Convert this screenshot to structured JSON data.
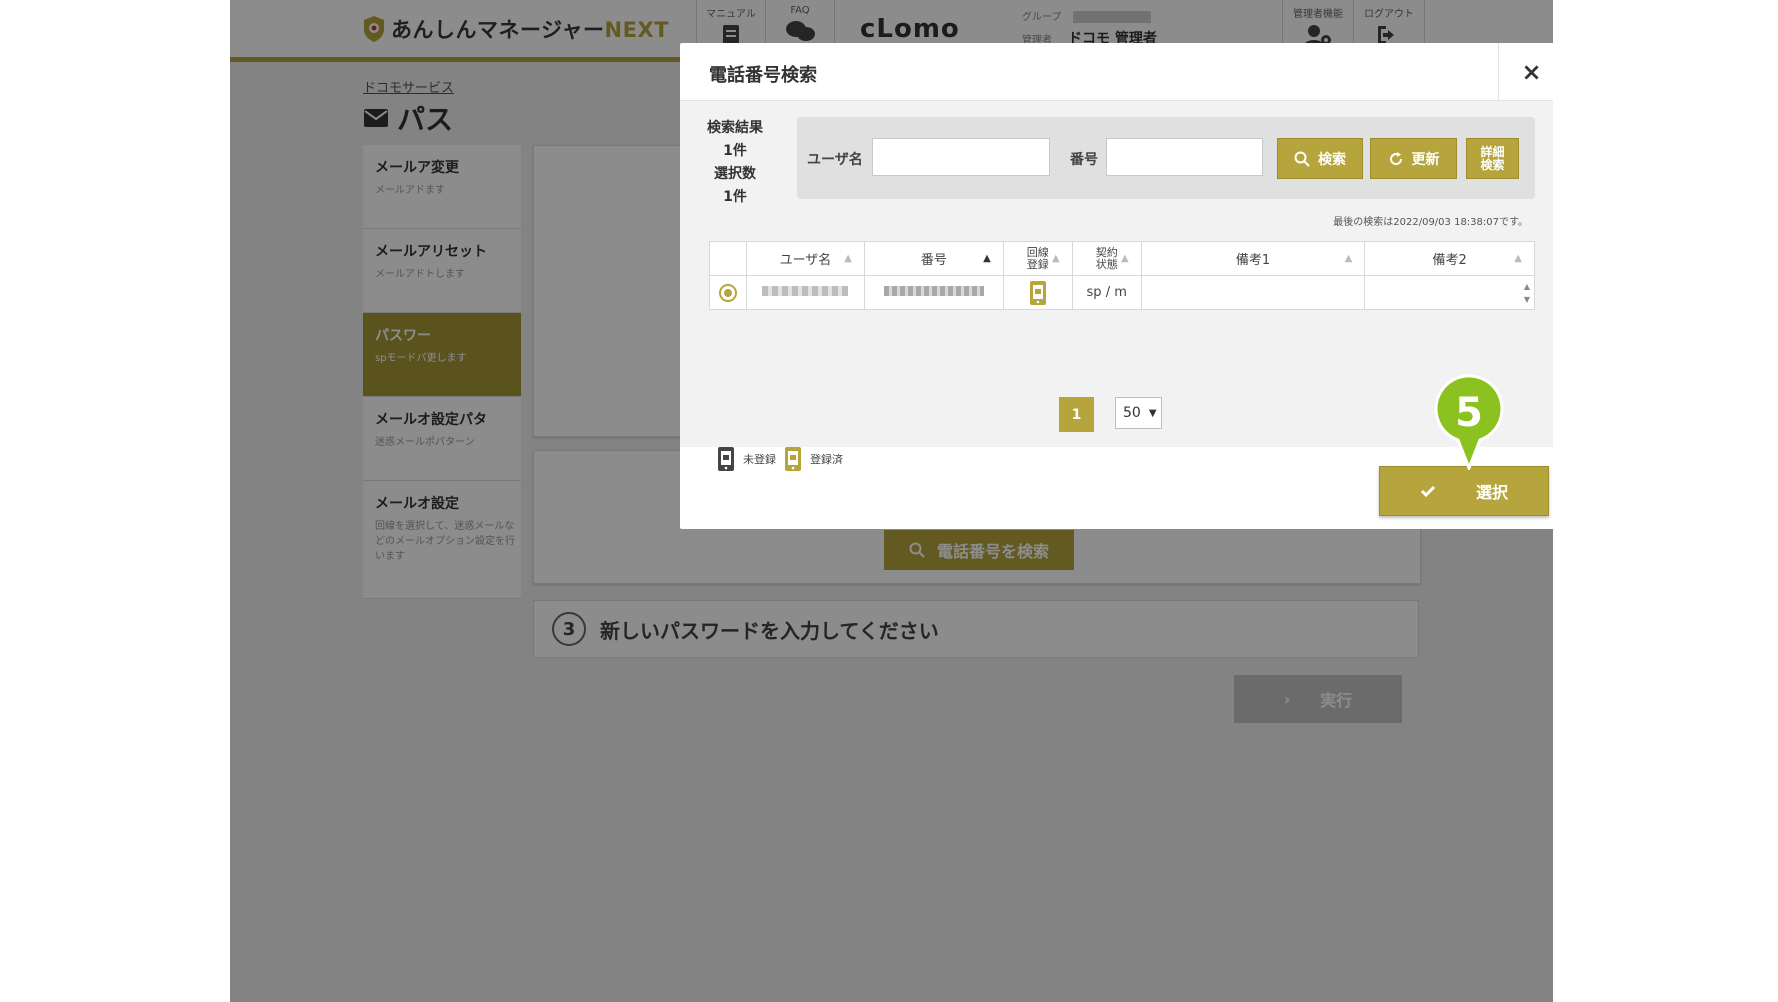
{
  "header": {
    "logo_text": "あんしんマネージャー",
    "logo_next": "NEXT",
    "nav_manual": "マニュアル",
    "nav_faq": "FAQ",
    "brand": "cLomo",
    "group_label": "グループ",
    "admin_label": "管理者",
    "admin_name": "ドコモ 管理者",
    "nav_admin": "管理者機能",
    "nav_logout": "ログアウト"
  },
  "page": {
    "breadcrumb": "ドコモサービス",
    "title": "パス",
    "side_items": [
      {
        "title": "メールア変更",
        "desc": "メールアドます"
      },
      {
        "title": "メールアリセット",
        "desc": "メールアドトします"
      },
      {
        "title": "パスワー",
        "desc": "spモードパ更します"
      },
      {
        "title": "メールオ設定パタ",
        "desc": "迷惑メールポパターン"
      },
      {
        "title": "メールオ設定",
        "desc": "回線を選択して、迷惑メールなどのメールオプション設定を行います"
      }
    ],
    "search_phone_button": "電話番号を検索",
    "step3_num": "3",
    "step3_label": "新しいパスワードを入力してください",
    "exec_button": "実行"
  },
  "modal": {
    "title": "電話番号検索",
    "close": "×",
    "result_label": "検索結果",
    "result_count": "1件",
    "selected_label": "選択数",
    "selected_count": "1件",
    "username_label": "ユーザ名",
    "username_value": "",
    "number_label": "番号",
    "number_value": "",
    "search_button": "検索",
    "refresh_button": "更新",
    "detail_button_1": "詳細",
    "detail_button_2": "検索",
    "last_search": "最後の検索は2022/09/03 18:38:07です。",
    "columns": [
      "ユーザ名",
      "番号",
      "回線登録",
      "契約状態",
      "備考1",
      "備考2"
    ],
    "rows": [
      {
        "user": "",
        "number": "",
        "status": "sp / m",
        "note1": "",
        "note2": ""
      }
    ],
    "page_number": "1",
    "per_page": "50",
    "legend_unregistered": "未登録",
    "legend_registered": "登録済",
    "select_button": "選択",
    "step_marker": "5"
  },
  "colors": {
    "accent": "#b5a53c",
    "marker": "#8cc21f"
  }
}
